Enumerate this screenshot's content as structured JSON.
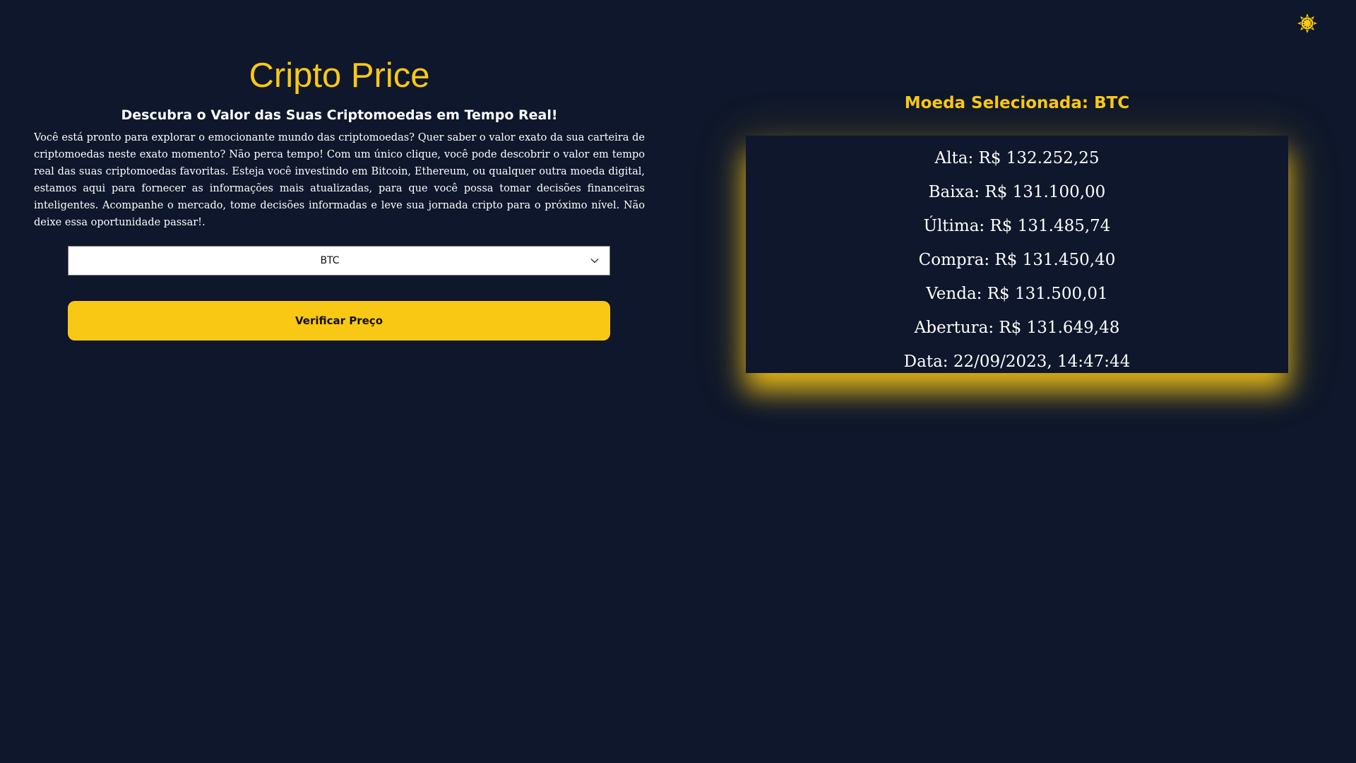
{
  "header": {
    "theme_toggle_icon": "sun-icon",
    "accent_color": "#f9c815",
    "background_color": "#0e172b"
  },
  "intro": {
    "title": "Cripto Price",
    "subtitle": "Descubra o Valor das Suas Criptomoedas em Tempo Real!",
    "paragraph": "Você está pronto para explorar o emocionante mundo das criptomoedas? Quer saber o valor exato da sua carteira de criptomoedas neste exato momento? Não perca tempo! Com um único clique, você pode descobrir o valor em tempo real das suas criptomoedas favoritas. Esteja você investindo em Bitcoin, Ethereum, ou qualquer outra moeda digital, estamos aqui para fornecer as informações mais atualizadas, para que você possa tomar decisões financeiras inteligentes. Acompanhe o mercado, tome decisões informadas e leve sua jornada cripto para o próximo nível. Não deixe essa oportunidade passar!."
  },
  "form": {
    "selected_coin": "BTC",
    "verify_button_label": "Verificar Preço"
  },
  "result": {
    "heading": "Moeda Selecionada: BTC",
    "rows": [
      "Alta: R$ 132.252,25",
      "Baixa: R$ 131.100,00",
      "Última: R$ 131.485,74",
      "Compra: R$ 131.450,40",
      "Venda: R$ 131.500,01",
      "Abertura: R$ 131.649,48",
      "Data: 22/09/2023, 14:47:44"
    ]
  }
}
